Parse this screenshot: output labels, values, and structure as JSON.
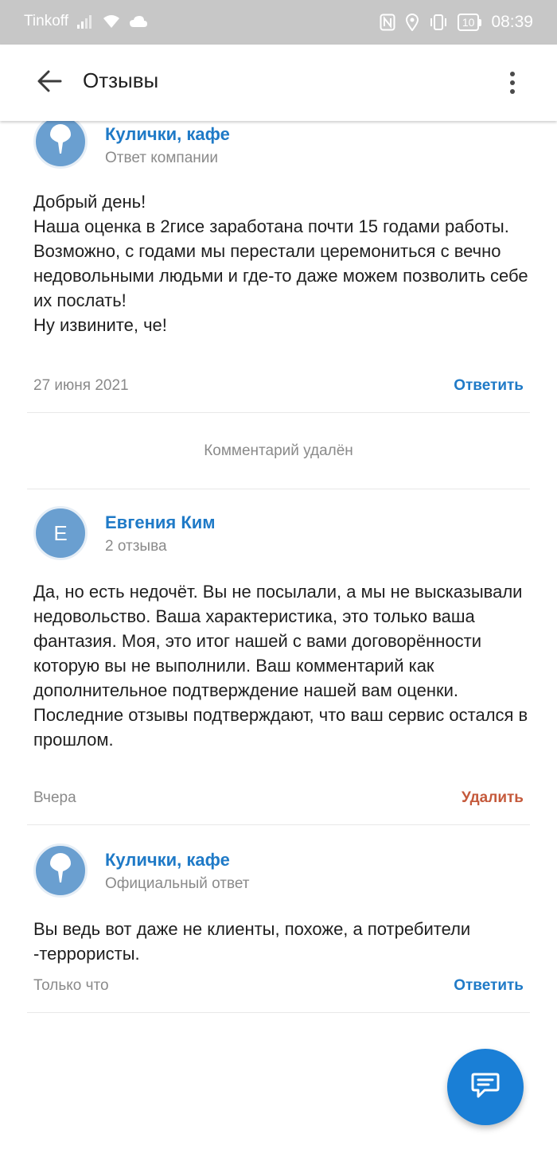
{
  "status_bar": {
    "carrier": "Tinkoff",
    "battery": "10",
    "time": "08:39",
    "icons": [
      "signal-icon",
      "wifi-icon",
      "cloud-icon",
      "nfc-icon",
      "location-icon",
      "vibrate-icon",
      "battery-icon"
    ]
  },
  "app_bar": {
    "title": "Отзывы",
    "back_icon": "arrow-back-icon",
    "menu_icon": "more-vert-icon"
  },
  "reviews": [
    {
      "author": "Кулички, кафе",
      "subtitle": "Ответ компании",
      "avatar": "cafe-logo-icon",
      "text": "Добрый день!\nНаша оценка в 2гисе заработана почти 15 годами работы.\nВозможно, с годами мы перестали церемониться с вечно недовольными людьми и где-то даже можем позволить себе их послать!\nНу извините, че!",
      "date": "27 июня 2021",
      "action": "Ответить"
    },
    {
      "deleted_note": "Комментарий удалён"
    },
    {
      "author": "Евгения Ким",
      "subtitle": "2 отзыва",
      "avatar_letter": "Е",
      "text": "Да, но есть недочёт. Вы не посылали, а мы не высказывали недовольство. Ваша характеристика, это только ваша фантазия. Моя, это итог нашей с вами договорённости которую вы не выполнили. Ваш комментарий как дополнительное подтверждение нашей вам оценки. Последние отзывы подтверждают, что ваш сервис остался в прошлом.",
      "date": "Вчера",
      "action": "Удалить"
    },
    {
      "author": "Кулички, кафе",
      "subtitle": "Официальный ответ",
      "avatar": "cafe-logo-icon",
      "text": "Вы ведь вот даже не клиенты, похоже, а потребители -террористы.",
      "date": "Только что",
      "action": "Ответить"
    }
  ],
  "fab": {
    "icon": "chat-icon"
  },
  "colors": {
    "accent": "#1f7ac7",
    "delete": "#c55a3c",
    "fab": "#1a7fd6",
    "avatar": "#6a9fd0",
    "status_bar": "#c7c7c7"
  }
}
